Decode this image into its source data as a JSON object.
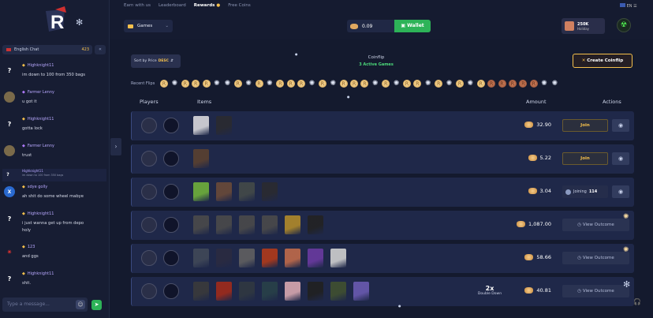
{
  "nav": {
    "earn": "Earn with us",
    "leaderboard": "Leaderboard",
    "rewards": "Rewards",
    "free_coins": "Free Coins",
    "lang": "EN"
  },
  "header": {
    "games_label": "Games",
    "balance": "0.09",
    "wallet_label": "Wallet",
    "holiday_value": "250K",
    "holiday_label": "Holiday"
  },
  "chat": {
    "room": "English Chat",
    "online": "423",
    "input_placeholder": "Type a message...",
    "messages": [
      {
        "name": "Highknight11",
        "text": "im down to 100 from 350 bags",
        "avatar": "?"
      },
      {
        "name": "Farmer Lenny",
        "text": "u got it",
        "avatar": ""
      },
      {
        "name": "Highknight11",
        "text": "gotta lock",
        "avatar": "?"
      },
      {
        "name": "Farmer Lenny",
        "text": "trust",
        "avatar": ""
      },
      {
        "name": "Highknight11",
        "text": "im down to 100 from 350 bags",
        "avatar": "?"
      },
      {
        "name": "sdye golly",
        "text": "ah shit do some wheel mabye",
        "avatar": "X"
      },
      {
        "name": "Highknight11",
        "text": "i just wanna get up from depo",
        "text2": "holy",
        "avatar": "?"
      },
      {
        "name": "123",
        "text": "and ggs",
        "avatar": ""
      },
      {
        "name": "Highknight11",
        "text": "shit.",
        "avatar": "?"
      }
    ]
  },
  "lobby": {
    "sort_label": "Sort by Price",
    "sort_value": "DESC",
    "title": "Coinflip",
    "active": "3 Active Games",
    "create_label": "Create Coinflip",
    "recent_label": "Recent Flips"
  },
  "recent_flips": [
    "g",
    "s",
    "g",
    "g",
    "g",
    "s",
    "s",
    "g",
    "s",
    "g",
    "s",
    "g",
    "g",
    "g",
    "s",
    "g",
    "s",
    "g",
    "g",
    "g",
    "s",
    "g",
    "s",
    "g",
    "g",
    "s",
    "g",
    "s",
    "g",
    "s",
    "g",
    "r",
    "r",
    "r",
    "r",
    "r",
    "s",
    "s"
  ],
  "columns": {
    "players": "Players",
    "items": "Items",
    "amount": "Amount",
    "actions": "Actions"
  },
  "rows": [
    {
      "amount": "32.90",
      "action": "join",
      "join_label": "Join",
      "items": [
        "#d8d8dc",
        "#2a2a30"
      ]
    },
    {
      "amount": "5.22",
      "action": "join",
      "join_label": "Join",
      "items": [
        "#5a4030"
      ]
    },
    {
      "amount": "3.04",
      "action": "joining",
      "joining_label": "Joining",
      "joining_count": "114",
      "items": [
        "#6fb03a",
        "#6a4a38",
        "#444a48",
        "#2a2a30"
      ]
    },
    {
      "amount": "1,087.00",
      "action": "view",
      "view_label": "View Outcome",
      "items": [
        "#4a4a4a",
        "#4a4a4a",
        "#4a4a4a",
        "#4a4a4a",
        "#b08a2a",
        "#222"
      ]
    },
    {
      "amount": "58.66",
      "action": "view",
      "view_label": "View Outcome",
      "items": [
        "#404858",
        "#2a2a40",
        "#606060",
        "#b03a1a",
        "#c06a4a",
        "#6a3aa0",
        "#d0d0d0"
      ]
    },
    {
      "amount": "40.81",
      "action": "view",
      "view_label": "View Outcome",
      "items": [
        "#3a3a3a",
        "#a02a1a",
        "#303840",
        "#284048",
        "#d8a8b0",
        "#202020",
        "#405030",
        "#6a5ab0"
      ],
      "multiplier": "2x",
      "multiplier_label": "Double Down"
    }
  ]
}
